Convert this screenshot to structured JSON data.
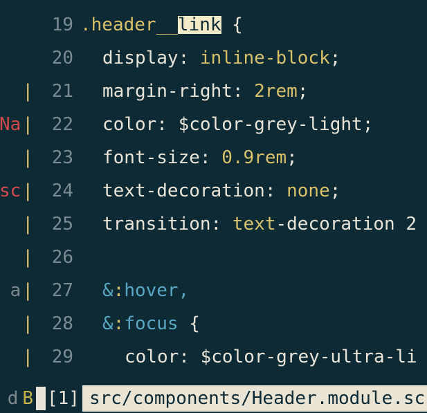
{
  "gutter_markers": [
    {
      "row": 3,
      "text": "",
      "cls": ""
    },
    {
      "row": 4,
      "text": "rNa",
      "cls": "mark-text-red"
    },
    {
      "row": 5,
      "text": "",
      "cls": ""
    },
    {
      "row": 6,
      "text": ".sc",
      "cls": "mark-text-red"
    },
    {
      "row": 7,
      "text": "",
      "cls": ""
    },
    {
      "row": 8,
      "text": "",
      "cls": ""
    },
    {
      "row": 9,
      "text": "\" a",
      "cls": "mark-text-grey"
    },
    {
      "row": 10,
      "text": "",
      "cls": ""
    }
  ],
  "line_numbers": [
    "19",
    "20",
    "21",
    "22",
    "23",
    "24",
    "25",
    "26",
    "27",
    "28",
    "29"
  ],
  "code_lines": {
    "l19": {
      "sel_pre": ".header__",
      "sel_hl": "link",
      "brace": " {"
    },
    "l20": {
      "prop": "display",
      "val": "inline-block"
    },
    "l21": {
      "prop": "margin-right",
      "num": "2rem"
    },
    "l22": {
      "prop": "color",
      "var": "$color-grey-light"
    },
    "l23": {
      "prop": "font-size",
      "num": "0.9rem"
    },
    "l24": {
      "prop": "text-decoration",
      "kw": "none"
    },
    "l25": {
      "prop": "transition",
      "w1": "text",
      "dash": "-",
      "w2": "decoration",
      "tail": " 2"
    },
    "l27": {
      "amp": "&",
      "colon": ":",
      "pseudo": "hover",
      "comma": ","
    },
    "l28": {
      "amp": "&",
      "colon": ":",
      "pseudo": "focus",
      "brace": " {"
    },
    "l29": {
      "prop": "color",
      "var": "$color-grey-ultra-li"
    }
  },
  "status": {
    "left_text": "d",
    "left_badge": "B",
    "buffer": "[1]",
    "path": "src/components/Header.module.scs"
  }
}
